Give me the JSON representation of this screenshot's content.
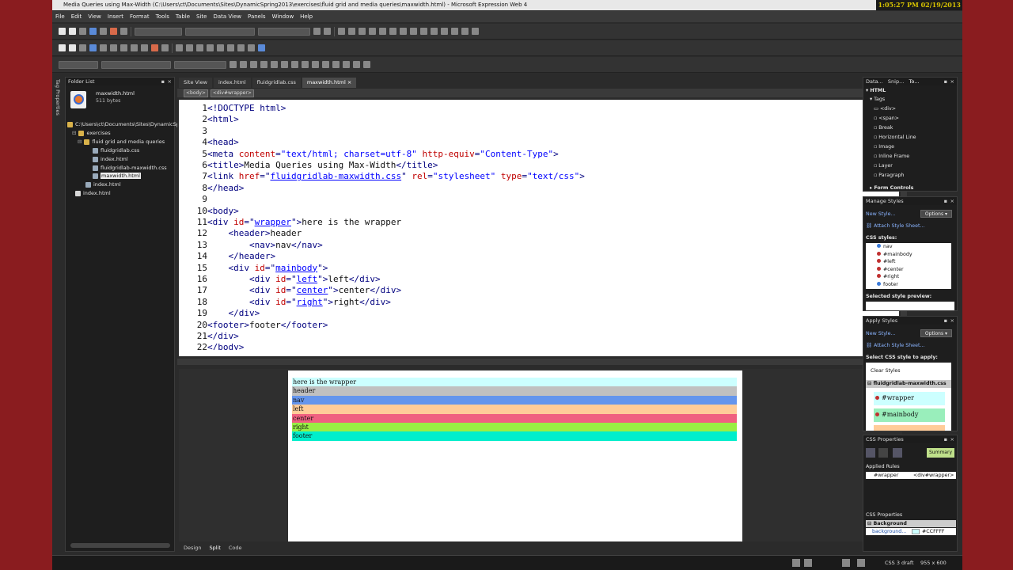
{
  "window": {
    "title": "Media Queries using Max-Width (C:\\Users\\ct\\Documents\\Sites\\DynamicSpring2013\\exercises\\fluid grid and media queries\\maxwidth.html) - Microsoft Expression Web 4",
    "clock": "1:05:27 PM 02/19/2013"
  },
  "menu": [
    "File",
    "Edit",
    "View",
    "Insert",
    "Format",
    "Tools",
    "Table",
    "Site",
    "Data View",
    "Panels",
    "Window",
    "Help"
  ],
  "left_vertical_tab": "Tag Properties",
  "folder_list": {
    "title": "Folder List",
    "file_name": "maxwidth.html",
    "file_size": "511 bytes",
    "root": "C:\\Users\\ct\\Documents\\Sites\\DynamicSpring",
    "items": [
      "exercises",
      "fluid grid and media queries",
      "fluidgridlab.css",
      "index.html",
      "fluidgridlab-maxwidth.css",
      "maxwidth.html",
      "index.html",
      "index.html"
    ]
  },
  "doc_tabs": [
    "Site View",
    "index.html",
    "fluidgridlab.css",
    "maxwidth.html"
  ],
  "quick_tags": [
    "<body>",
    "<div#wrapper>"
  ],
  "code_lines": {
    "n1": "1",
    "n2": "2",
    "n3": "3",
    "n4": "4",
    "n5": "5",
    "n6": "6",
    "n7": "7",
    "n8": "8",
    "n9": "9",
    "n10": "10",
    "n11": "11",
    "n12": "12",
    "n13": "13",
    "n14": "14",
    "n15": "15",
    "n16": "16",
    "n17": "17",
    "n18": "18",
    "n19": "19",
    "n20": "20",
    "n21": "21",
    "n22": "22",
    "l1": "<!DOCTYPE html>",
    "l2": "<html>",
    "l4": "<head>",
    "l5a": "<meta ",
    "l5b": "content",
    "l5c": "=",
    "l5d": "\"text/html; charset=utf-8\"",
    "l5e": " http-equiv",
    "l5f": "=",
    "l5g": "\"Content-Type\"",
    "l5h": ">",
    "l6a": "<title>",
    "l6b": "Media Queries using Max-Width",
    "l6c": "</title>",
    "l7a": "<link ",
    "l7b": "href",
    "l7c": "=\"",
    "l7d": "fluidgridlab-maxwidth.css",
    "l7e": "\"",
    "l7f": " rel",
    "l7g": "=",
    "l7h": "\"stylesheet\"",
    "l7i": " type",
    "l7j": "=",
    "l7k": "\"text/css\"",
    "l7l": ">",
    "l8": "</head>",
    "l10": "<body>",
    "l11a": "<div ",
    "l11b": "id",
    "l11c": "=\"",
    "l11d": "wrapper",
    "l11e": "\">",
    "l11f": "here is the wrapper",
    "l12a": "<header>",
    "l12b": "header",
    "l13a": "<nav>",
    "l13b": "nav",
    "l13c": "</nav>",
    "l14": "</header>",
    "l15a": "<div ",
    "l15b": "id",
    "l15c": "=\"",
    "l15d": "mainbody",
    "l15e": "\">",
    "l16a": "<div ",
    "l16b": "id",
    "l16c": "=\"",
    "l16d": "left",
    "l16e": "\">",
    "l16f": "left",
    "l16g": "</div>",
    "l17a": "<div ",
    "l17b": "id",
    "l17c": "=\"",
    "l17d": "center",
    "l17e": "\">",
    "l17f": "center",
    "l17g": "</div>",
    "l18a": "<div ",
    "l18b": "id",
    "l18c": "=\"",
    "l18d": "right",
    "l18e": "\">",
    "l18f": "right",
    "l18g": "</div>",
    "l19": "</div>",
    "l20a": "<footer>",
    "l20b": "footer",
    "l20c": "</footer>",
    "l21": "</div>",
    "l22": "</body>"
  },
  "design_preview": [
    {
      "text": "here is the wrapper",
      "color": "#ccffff"
    },
    {
      "text": "header",
      "color": "#c0c0c0"
    },
    {
      "text": "nav",
      "color": "#6495ed"
    },
    {
      "text": "left",
      "color": "#ffcc99"
    },
    {
      "text": "center",
      "color": "#f06080"
    },
    {
      "text": "right",
      "color": "#99ee44"
    },
    {
      "text": "footer",
      "color": "#00eecc"
    }
  ],
  "view_tabs": [
    "Design",
    "Split",
    "Code"
  ],
  "toolbox": {
    "tabs": [
      "Data...",
      "Snip...",
      "To..."
    ],
    "section": "HTML",
    "subsection": "Tags",
    "items": [
      "<div>",
      "<span>",
      "Break",
      "Horizontal Line",
      "Image",
      "Inline Frame",
      "Layer",
      "Paragraph"
    ],
    "next_section": "Form Controls"
  },
  "manage_styles": {
    "title": "Manage Styles",
    "new_style": "New Style...",
    "options": "Options",
    "attach": "Attach Style Sheet...",
    "css_styles_label": "CSS styles:",
    "styles": [
      "nav",
      "#mainbody",
      "#left",
      "#center",
      "#right",
      "footer"
    ],
    "preview_label": "Selected style preview:"
  },
  "apply_styles": {
    "title": "Apply Styles",
    "new_style": "New Style...",
    "options": "Options",
    "attach": "Attach Style Sheet...",
    "select_label": "Select CSS style to apply:",
    "clear": "Clear Styles",
    "sheet": "fluidgridlab-maxwidth.css",
    "items": [
      "#wrapper",
      "#mainbody"
    ]
  },
  "css_properties": {
    "title": "CSS Properties",
    "summary": "Summary",
    "applied_rules_label": "Applied Rules",
    "rule_name": "#wrapper",
    "rule_tag": "<div#wrapper>",
    "props_label": "CSS Properties",
    "category": "Background",
    "prop_name": "background...",
    "prop_value": "#CCFFFF"
  },
  "status": {
    "css": "CSS 3 draft",
    "size": "955 x 600"
  }
}
